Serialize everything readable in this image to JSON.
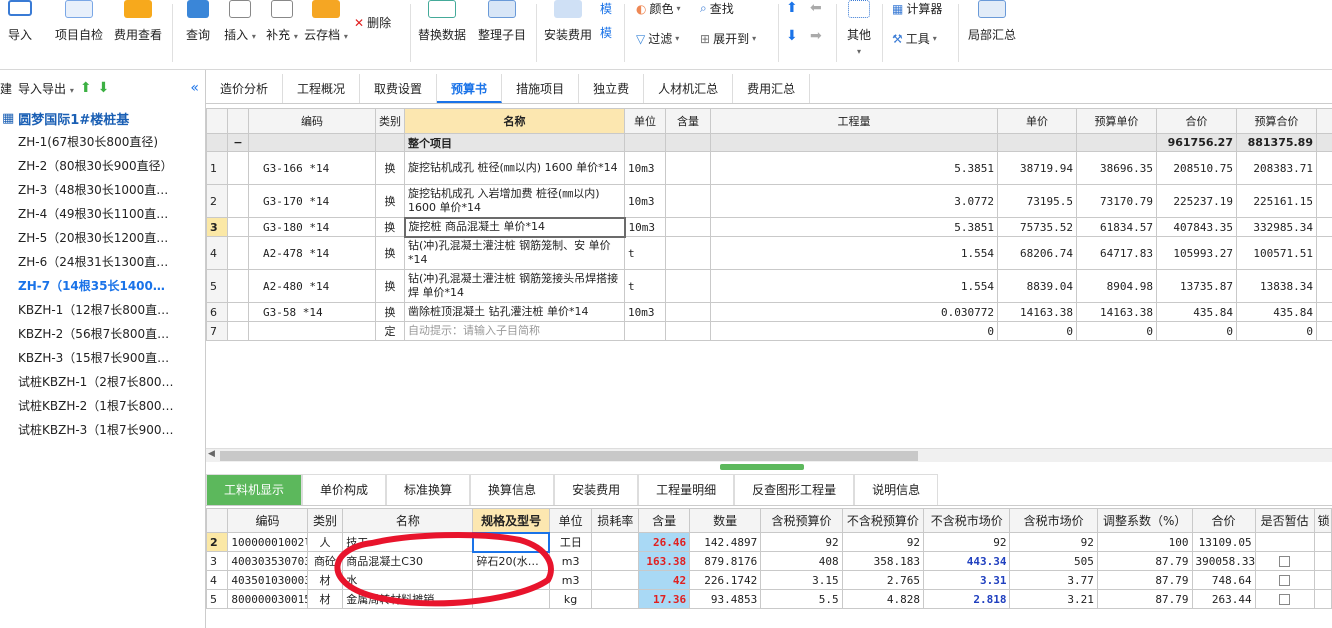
{
  "ribbon": {
    "import": "导入",
    "self_check": "项目自检",
    "fee_view": "费用查看",
    "query": "查询",
    "insert": "插入",
    "supplement": "补充",
    "cloud_save": "云存档",
    "delete": "删除",
    "replace_data": "替换数据",
    "organize": "整理子目",
    "install_fee": "安装费用",
    "template_1": "模",
    "template_2": "模",
    "color": "颜色",
    "find": "查找",
    "filter": "过滤",
    "expand_to": "展开到",
    "other": "其他",
    "calculator": "计算器",
    "tools": "工具",
    "partial_sum": "局部汇总"
  },
  "left": {
    "new": "新建",
    "import_export": "导入导出",
    "root": "圆梦国际1#楼桩基",
    "items": [
      "ZH-1(67根30长800直径)",
      "ZH-2（80根30长900直径）",
      "ZH-3（48根30长1000直…",
      "ZH-4（49根30长1100直…",
      "ZH-5（20根30长1200直…",
      "ZH-6（24根31长1300直…",
      "ZH-7（14根35长1400…",
      "KBZH-1（12根7长800直…",
      "KBZH-2（56根7长800直…",
      "KBZH-3（15根7长900直…",
      "试桩KBZH-1（2根7长800…",
      "试桩KBZH-2（1根7长800…",
      "试桩KBZH-3（1根7长900…"
    ],
    "selected_index": 6
  },
  "tabs": [
    "造价分析",
    "工程概况",
    "取费设置",
    "预算书",
    "措施项目",
    "独立费",
    "人材机汇总",
    "费用汇总"
  ],
  "active_tab": "预算书",
  "grid": {
    "headers": [
      "",
      "",
      "编码",
      "类别",
      "名称",
      "单位",
      "含量",
      "工程量",
      "单价",
      "预算单价",
      "合价",
      "预算合价"
    ],
    "summary": {
      "label": "整个项目",
      "total": "961756.27",
      "budget_total": "881375.89",
      "collapse": "−"
    },
    "rows": [
      {
        "no": "1",
        "code": "G3-166 *14",
        "type": "换",
        "name": "旋挖钻机成孔 桩径(㎜以内) 1600  单价*14",
        "unit": "10m3",
        "qty": "5.3851",
        "price": "38719.94",
        "bprice": "38696.35",
        "total": "208510.75",
        "btotal": "208383.71"
      },
      {
        "no": "2",
        "code": "G3-170 *14",
        "type": "换",
        "name": "旋挖钻机成孔 入岩增加费 桩径(㎜以内) 1600  单价*14",
        "unit": "10m3",
        "qty": "3.0772",
        "price": "73195.5",
        "bprice": "73170.79",
        "total": "225237.19",
        "btotal": "225161.15"
      },
      {
        "no": "3",
        "code": "G3-180 *14",
        "type": "换",
        "name": "旋挖桩 商品混凝土  单价*14",
        "unit": "10m3",
        "qty": "5.3851",
        "price": "75735.52",
        "bprice": "61834.57",
        "total": "407843.35",
        "btotal": "332985.34"
      },
      {
        "no": "4",
        "code": "A2-478 *14",
        "type": "换",
        "name": "钻(冲)孔混凝土灌注桩 钢筋笼制、安  单价*14",
        "unit": "t",
        "qty": "1.554",
        "price": "68206.74",
        "bprice": "64717.83",
        "total": "105993.27",
        "btotal": "100571.51"
      },
      {
        "no": "5",
        "code": "A2-480 *14",
        "type": "换",
        "name": "钻(冲)孔混凝土灌注桩 钢筋笼接头吊焊搭接焊  单价*14",
        "unit": "t",
        "qty": "1.554",
        "price": "8839.04",
        "bprice": "8904.98",
        "total": "13735.87",
        "btotal": "13838.34"
      },
      {
        "no": "6",
        "code": "G3-58 *14",
        "type": "换",
        "name": "凿除桩顶混凝土 钻孔灌注桩  单价*14",
        "unit": "10m3",
        "qty": "0.030772",
        "price": "14163.38",
        "bprice": "14163.38",
        "total": "435.84",
        "btotal": "435.84"
      },
      {
        "no": "7",
        "code": "",
        "type": "定",
        "name": "自动提示：请输入子目简称",
        "unit": "",
        "qty": "0",
        "price": "0",
        "bprice": "0",
        "total": "0",
        "btotal": "0"
      }
    ],
    "selected_row": "3"
  },
  "bottom_tabs": [
    "工料机显示",
    "单价构成",
    "标准换算",
    "换算信息",
    "安装费用",
    "工程量明细",
    "反查图形工程量",
    "说明信息"
  ],
  "active_bottom_tab": "工料机显示",
  "bgrid": {
    "headers": [
      "",
      "编码",
      "类别",
      "名称",
      "规格及型号",
      "单位",
      "损耗率",
      "含量",
      "数量",
      "含税预算价",
      "不含税预算价",
      "不含税市场价",
      "含税市场价",
      "调整系数（%）",
      "合价",
      "是否暂估",
      "锁"
    ],
    "rows": [
      {
        "no": "2",
        "code": "10000001002l",
        "type": "人",
        "name": "技工",
        "spec": "",
        "unit": "工日",
        "loss": "",
        "content": "26.46",
        "qty": "142.4897",
        "p1": "92",
        "p2": "92",
        "p3": "92",
        "p4": "92",
        "adj": "100",
        "total": "13109.05",
        "est": false
      },
      {
        "no": "3",
        "code": "400303530703",
        "type": "商砼",
        "name": "商品混凝土C30",
        "spec": "碎石20(水…",
        "unit": "m3",
        "loss": "",
        "content": "163.38",
        "qty": "879.8176",
        "p1": "408",
        "p2": "358.183",
        "p3": "443.34",
        "p4": "505",
        "adj": "87.79",
        "total": "390058.33",
        "est": true
      },
      {
        "no": "4",
        "code": "403501030003",
        "type": "材",
        "name": "水",
        "spec": "",
        "unit": "m3",
        "loss": "",
        "content": "42",
        "qty": "226.1742",
        "p1": "3.15",
        "p2": "2.765",
        "p3": "3.31",
        "p4": "3.77",
        "adj": "87.79",
        "total": "748.64",
        "est": true
      },
      {
        "no": "5",
        "code": "800000030015",
        "type": "材",
        "name": "金属周转材料摊销",
        "spec": "",
        "unit": "kg",
        "loss": "",
        "content": "17.36",
        "qty": "93.4853",
        "p1": "5.5",
        "p2": "4.828",
        "p3": "2.818",
        "p4": "3.21",
        "adj": "87.79",
        "total": "263.44",
        "est": true
      }
    ]
  },
  "colors": {
    "accent": "#1a73e8",
    "green": "#5cb85c",
    "highlight": "#fce7b0",
    "annotation": "#e8142c"
  }
}
